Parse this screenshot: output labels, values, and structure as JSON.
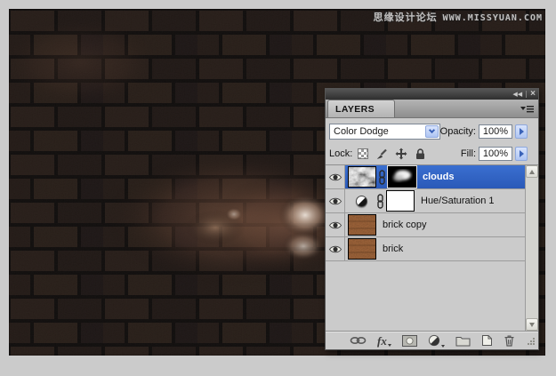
{
  "watermark": {
    "site_name": "思缘设计论坛",
    "site_url": "WWW.MISSYUAN.COM"
  },
  "panel": {
    "title": "LAYERS",
    "window_controls": {
      "collapse_glyph": "◀◀",
      "close_glyph": "×"
    },
    "blend_mode": {
      "value": "Color Dodge"
    },
    "opacity": {
      "label": "Opacity:",
      "value": "100%"
    },
    "fill": {
      "label": "Fill:",
      "value": "100%"
    },
    "lock": {
      "label": "Lock:",
      "icons": [
        "lock-transparent-pixels",
        "lock-image-pixels",
        "lock-position",
        "lock-all"
      ]
    },
    "layers": [
      {
        "name": "clouds",
        "type": "image layer with layer mask",
        "selected": true,
        "visible": true
      },
      {
        "name": "Hue/Saturation 1",
        "type": "adjustment layer with mask",
        "selected": false,
        "visible": true
      },
      {
        "name": "brick copy",
        "type": "image layer",
        "selected": false,
        "visible": true
      },
      {
        "name": "brick",
        "type": "image layer",
        "selected": false,
        "visible": true
      }
    ],
    "toolbar": {
      "fx_label": "fx",
      "icons": [
        "link-layers-icon",
        "layer-style-fx-icon",
        "add-layer-mask-icon",
        "new-adjustment-layer-icon",
        "new-group-icon",
        "new-layer-icon",
        "delete-layer-icon"
      ]
    },
    "colors": {
      "selection_blue": "#2e63c6",
      "panel_gray": "#cbcbcb",
      "titlebar_dark": "#3c3c3c",
      "xp_button_blue": "#b9cdf4"
    }
  }
}
